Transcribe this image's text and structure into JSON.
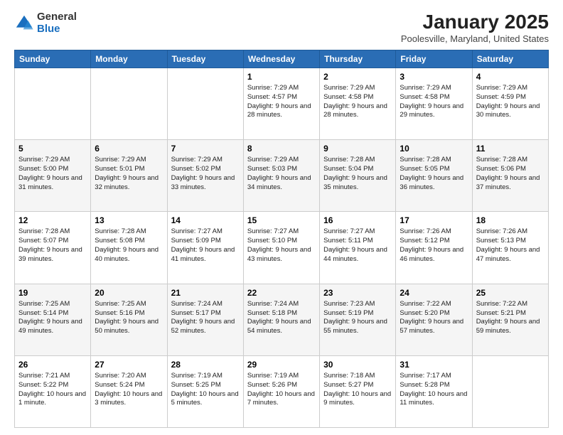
{
  "header": {
    "logo": {
      "general": "General",
      "blue": "Blue"
    },
    "title": "January 2025",
    "location": "Poolesville, Maryland, United States"
  },
  "weekdays": [
    "Sunday",
    "Monday",
    "Tuesday",
    "Wednesday",
    "Thursday",
    "Friday",
    "Saturday"
  ],
  "weeks": [
    [
      {
        "day": "",
        "content": ""
      },
      {
        "day": "",
        "content": ""
      },
      {
        "day": "",
        "content": ""
      },
      {
        "day": "1",
        "content": "Sunrise: 7:29 AM\nSunset: 4:57 PM\nDaylight: 9 hours\nand 28 minutes."
      },
      {
        "day": "2",
        "content": "Sunrise: 7:29 AM\nSunset: 4:58 PM\nDaylight: 9 hours\nand 28 minutes."
      },
      {
        "day": "3",
        "content": "Sunrise: 7:29 AM\nSunset: 4:58 PM\nDaylight: 9 hours\nand 29 minutes."
      },
      {
        "day": "4",
        "content": "Sunrise: 7:29 AM\nSunset: 4:59 PM\nDaylight: 9 hours\nand 30 minutes."
      }
    ],
    [
      {
        "day": "5",
        "content": "Sunrise: 7:29 AM\nSunset: 5:00 PM\nDaylight: 9 hours\nand 31 minutes."
      },
      {
        "day": "6",
        "content": "Sunrise: 7:29 AM\nSunset: 5:01 PM\nDaylight: 9 hours\nand 32 minutes."
      },
      {
        "day": "7",
        "content": "Sunrise: 7:29 AM\nSunset: 5:02 PM\nDaylight: 9 hours\nand 33 minutes."
      },
      {
        "day": "8",
        "content": "Sunrise: 7:29 AM\nSunset: 5:03 PM\nDaylight: 9 hours\nand 34 minutes."
      },
      {
        "day": "9",
        "content": "Sunrise: 7:28 AM\nSunset: 5:04 PM\nDaylight: 9 hours\nand 35 minutes."
      },
      {
        "day": "10",
        "content": "Sunrise: 7:28 AM\nSunset: 5:05 PM\nDaylight: 9 hours\nand 36 minutes."
      },
      {
        "day": "11",
        "content": "Sunrise: 7:28 AM\nSunset: 5:06 PM\nDaylight: 9 hours\nand 37 minutes."
      }
    ],
    [
      {
        "day": "12",
        "content": "Sunrise: 7:28 AM\nSunset: 5:07 PM\nDaylight: 9 hours\nand 39 minutes."
      },
      {
        "day": "13",
        "content": "Sunrise: 7:28 AM\nSunset: 5:08 PM\nDaylight: 9 hours\nand 40 minutes."
      },
      {
        "day": "14",
        "content": "Sunrise: 7:27 AM\nSunset: 5:09 PM\nDaylight: 9 hours\nand 41 minutes."
      },
      {
        "day": "15",
        "content": "Sunrise: 7:27 AM\nSunset: 5:10 PM\nDaylight: 9 hours\nand 43 minutes."
      },
      {
        "day": "16",
        "content": "Sunrise: 7:27 AM\nSunset: 5:11 PM\nDaylight: 9 hours\nand 44 minutes."
      },
      {
        "day": "17",
        "content": "Sunrise: 7:26 AM\nSunset: 5:12 PM\nDaylight: 9 hours\nand 46 minutes."
      },
      {
        "day": "18",
        "content": "Sunrise: 7:26 AM\nSunset: 5:13 PM\nDaylight: 9 hours\nand 47 minutes."
      }
    ],
    [
      {
        "day": "19",
        "content": "Sunrise: 7:25 AM\nSunset: 5:14 PM\nDaylight: 9 hours\nand 49 minutes."
      },
      {
        "day": "20",
        "content": "Sunrise: 7:25 AM\nSunset: 5:16 PM\nDaylight: 9 hours\nand 50 minutes."
      },
      {
        "day": "21",
        "content": "Sunrise: 7:24 AM\nSunset: 5:17 PM\nDaylight: 9 hours\nand 52 minutes."
      },
      {
        "day": "22",
        "content": "Sunrise: 7:24 AM\nSunset: 5:18 PM\nDaylight: 9 hours\nand 54 minutes."
      },
      {
        "day": "23",
        "content": "Sunrise: 7:23 AM\nSunset: 5:19 PM\nDaylight: 9 hours\nand 55 minutes."
      },
      {
        "day": "24",
        "content": "Sunrise: 7:22 AM\nSunset: 5:20 PM\nDaylight: 9 hours\nand 57 minutes."
      },
      {
        "day": "25",
        "content": "Sunrise: 7:22 AM\nSunset: 5:21 PM\nDaylight: 9 hours\nand 59 minutes."
      }
    ],
    [
      {
        "day": "26",
        "content": "Sunrise: 7:21 AM\nSunset: 5:22 PM\nDaylight: 10 hours\nand 1 minute."
      },
      {
        "day": "27",
        "content": "Sunrise: 7:20 AM\nSunset: 5:24 PM\nDaylight: 10 hours\nand 3 minutes."
      },
      {
        "day": "28",
        "content": "Sunrise: 7:19 AM\nSunset: 5:25 PM\nDaylight: 10 hours\nand 5 minutes."
      },
      {
        "day": "29",
        "content": "Sunrise: 7:19 AM\nSunset: 5:26 PM\nDaylight: 10 hours\nand 7 minutes."
      },
      {
        "day": "30",
        "content": "Sunrise: 7:18 AM\nSunset: 5:27 PM\nDaylight: 10 hours\nand 9 minutes."
      },
      {
        "day": "31",
        "content": "Sunrise: 7:17 AM\nSunset: 5:28 PM\nDaylight: 10 hours\nand 11 minutes."
      },
      {
        "day": "",
        "content": ""
      }
    ]
  ]
}
